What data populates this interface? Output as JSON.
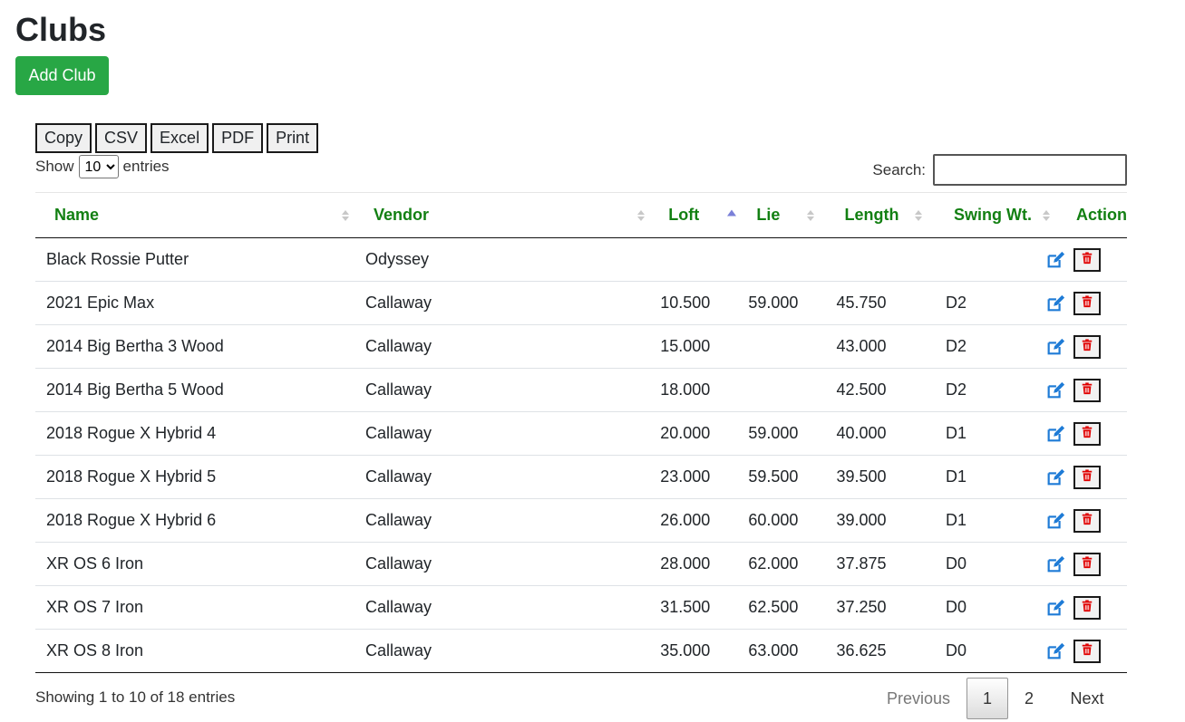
{
  "page": {
    "title": "Clubs",
    "add_label": "Add Club"
  },
  "export_buttons": [
    "Copy",
    "CSV",
    "Excel",
    "PDF",
    "Print"
  ],
  "length": {
    "show_label": "Show",
    "selected": "10",
    "entries_label": "entries"
  },
  "search": {
    "label": "Search:",
    "value": "",
    "placeholder": ""
  },
  "table": {
    "columns": [
      "Name",
      "Vendor",
      "Loft",
      "Lie",
      "Length",
      "Swing Wt.",
      "Action"
    ],
    "sorted_column": "Loft",
    "rows": [
      {
        "name": "Black Rossie Putter",
        "vendor": "Odyssey",
        "loft": "",
        "lie": "",
        "length": "",
        "swing": ""
      },
      {
        "name": "2021 Epic Max",
        "vendor": "Callaway",
        "loft": "10.500",
        "lie": "59.000",
        "length": "45.750",
        "swing": "D2"
      },
      {
        "name": "2014 Big Bertha 3 Wood",
        "vendor": "Callaway",
        "loft": "15.000",
        "lie": "",
        "length": "43.000",
        "swing": "D2"
      },
      {
        "name": "2014 Big Bertha 5 Wood",
        "vendor": "Callaway",
        "loft": "18.000",
        "lie": "",
        "length": "42.500",
        "swing": "D2"
      },
      {
        "name": "2018 Rogue X Hybrid 4",
        "vendor": "Callaway",
        "loft": "20.000",
        "lie": "59.000",
        "length": "40.000",
        "swing": "D1"
      },
      {
        "name": "2018 Rogue X Hybrid 5",
        "vendor": "Callaway",
        "loft": "23.000",
        "lie": "59.500",
        "length": "39.500",
        "swing": "D1"
      },
      {
        "name": "2018 Rogue X Hybrid 6",
        "vendor": "Callaway",
        "loft": "26.000",
        "lie": "60.000",
        "length": "39.000",
        "swing": "D1"
      },
      {
        "name": "XR OS 6 Iron",
        "vendor": "Callaway",
        "loft": "28.000",
        "lie": "62.000",
        "length": "37.875",
        "swing": "D0"
      },
      {
        "name": "XR OS 7 Iron",
        "vendor": "Callaway",
        "loft": "31.500",
        "lie": "62.500",
        "length": "37.250",
        "swing": "D0"
      },
      {
        "name": "XR OS 8 Iron",
        "vendor": "Callaway",
        "loft": "35.000",
        "lie": "63.000",
        "length": "36.625",
        "swing": "D0"
      }
    ],
    "row_icons": {
      "edit": "edit-icon",
      "delete": "trash-icon"
    }
  },
  "footer": {
    "info": "Showing 1 to 10 of 18 entries",
    "pagination": {
      "previous": "Previous",
      "pages": [
        "1",
        "2"
      ],
      "current": "1",
      "next": "Next"
    }
  },
  "colors": {
    "accent_green": "#28a745",
    "header_text": "#138013",
    "edit_blue": "#1e7bd6",
    "delete_red": "#e00000"
  }
}
